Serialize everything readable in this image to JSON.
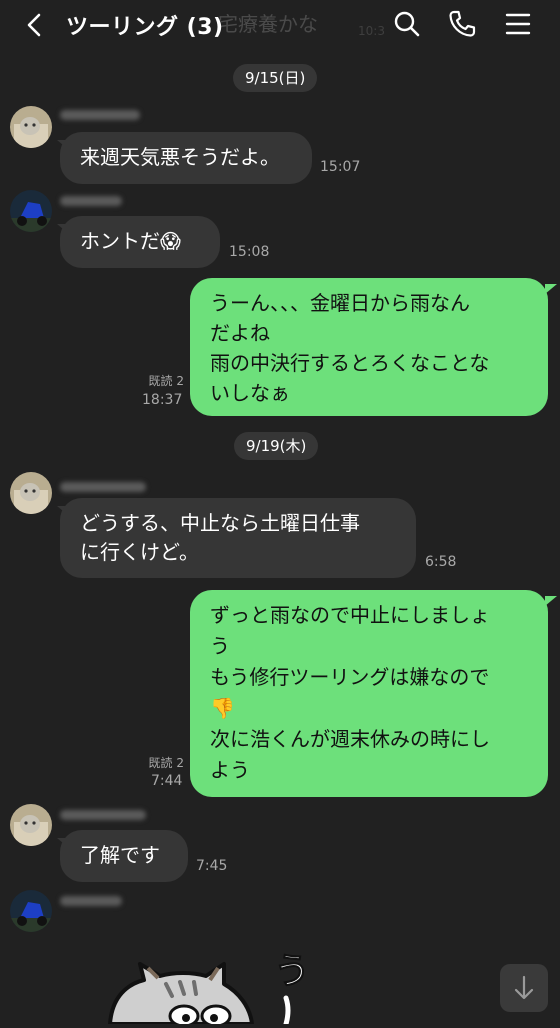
{
  "header": {
    "title": "ツーリング (3)",
    "ghost_text": "宅療養かな",
    "ghost_time": "10:3"
  },
  "dates": [
    "9/15(日)",
    "9/19(木)"
  ],
  "messages": [
    {
      "side": "in",
      "lines": [
        "来週天気悪そうだよ。"
      ],
      "time": "15:07"
    },
    {
      "side": "in",
      "lines": [
        "ホントだ😱"
      ],
      "time": "15:08"
    },
    {
      "side": "out",
      "lines": [
        "うーん、、、金曜日から雨なん",
        "だよね",
        "雨の中決行するとろくなことな",
        "いしなぁ"
      ],
      "read": "既読 2",
      "time": "18:37"
    },
    {
      "side": "in",
      "lines": [
        "どうする、中止なら土曜日仕事",
        "に行くけど。"
      ],
      "time": "6:58"
    },
    {
      "side": "out",
      "lines": [
        "ずっと雨なので中止にしましょ",
        "う",
        "もう修行ツーリングは嫌なので",
        "👎",
        "次に浩くんが週末休みの時にし",
        "よう"
      ],
      "read": "既読 2",
      "time": "7:44"
    },
    {
      "side": "in",
      "lines": [
        "了解です"
      ],
      "time": "7:45"
    }
  ],
  "sticker_text": "う",
  "colors": {
    "background": "#212121",
    "incoming_bubble": "#363636",
    "outgoing_bubble": "#6de07b",
    "date_pill": "#363636"
  },
  "icons": {
    "back": "chevron-left-icon",
    "search": "search-icon",
    "call": "phone-icon",
    "menu": "hamburger-menu-icon",
    "scroll": "arrow-down-icon"
  }
}
